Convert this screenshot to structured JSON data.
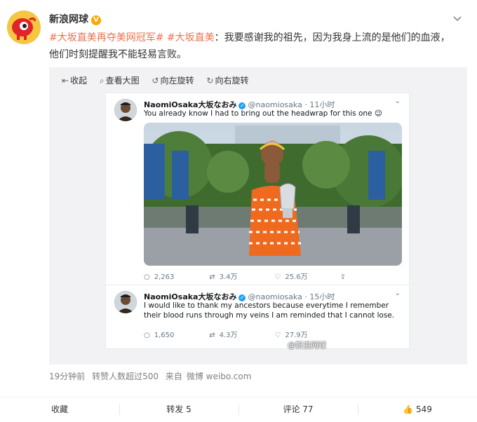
{
  "post": {
    "author": "新浪网球",
    "verified_mark": "V",
    "hashtag1": "#大坂直美再夺美网冠军#",
    "hashtag2": "#大坂直美",
    "text": "：我要感谢我的祖先，因为我身上流的是他们的血液，他们时刻提醒我不能轻易言败。",
    "meta": {
      "time": "19分钟前",
      "reposts_info": "转赞人数超过500",
      "source_prefix": "来自",
      "source": "微博 weibo.com"
    }
  },
  "toolbar": {
    "collapse": "收起",
    "view_large": "查看大图",
    "rotate_left": "向左旋转",
    "rotate_right": "向右旋转"
  },
  "tweets": [
    {
      "name": "NaomiOsaka大坂なおみ",
      "handle": "@naomiosaka",
      "time": "11小时",
      "text": "You already know I had to bring out the headwrap for this one 😉",
      "replies": "2,263",
      "retweets": "3.4万",
      "likes": "25.6万"
    },
    {
      "name": "NaomiOsaka大坂なおみ",
      "handle": "@naomiosaka",
      "time": "15小时",
      "text": "I would like to thank my ancestors because everytime I remember their blood runs through my veins I am reminded that I cannot lose.",
      "replies": "1,650",
      "retweets": "4.3万",
      "likes": "27.9万"
    }
  ],
  "watermark": "@新浪网球",
  "bottom": {
    "favorite": "收藏",
    "repost": "转发 5",
    "comment": "评论 77",
    "like": "549"
  },
  "colors": {
    "tag": "#eb7350",
    "accent": "#1da1f2",
    "badge": "#ffa500"
  }
}
